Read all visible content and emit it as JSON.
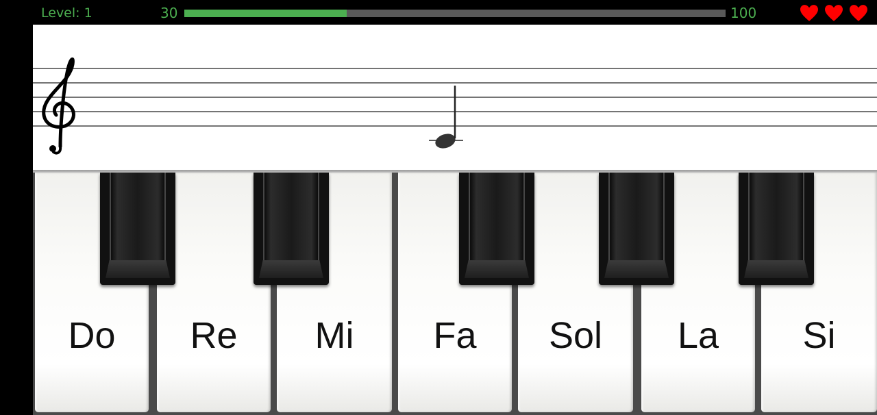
{
  "hud": {
    "level_text": "Level: 1",
    "progress_min": "30",
    "progress_max": "100",
    "progress_fraction": 0.3,
    "lives": 3,
    "accent_color": "#4caf50",
    "heart_color": "#ff0000"
  },
  "staff": {
    "clef_icon": "treble-clef-icon",
    "note_icon": "quarter-note-icon",
    "current_note": "C4",
    "has_ledger_line": true
  },
  "keyboard": {
    "white_keys": [
      {
        "label": "Do"
      },
      {
        "label": "Re"
      },
      {
        "label": "Mi"
      },
      {
        "label": "Fa"
      },
      {
        "label": "Sol"
      },
      {
        "label": "La"
      },
      {
        "label": "Si"
      }
    ]
  }
}
